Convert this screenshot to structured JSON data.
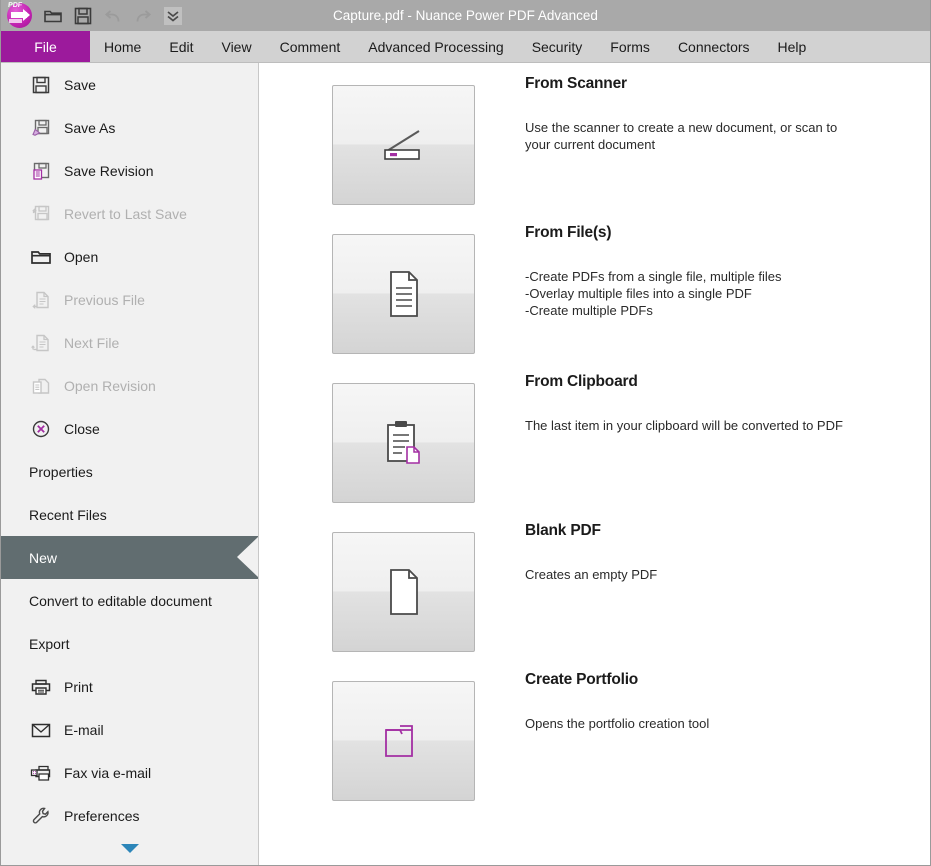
{
  "window": {
    "title": "Capture.pdf - Nuance Power PDF Advanced",
    "logo_icon": "pdf-logo-icon"
  },
  "quick_access_toolbar": {
    "buttons": [
      {
        "name": "open-icon",
        "label": "Open",
        "enabled": true
      },
      {
        "name": "save-icon",
        "label": "Save",
        "enabled": true
      },
      {
        "name": "undo-icon",
        "label": "Undo",
        "enabled": false
      },
      {
        "name": "redo-icon",
        "label": "Redo",
        "enabled": false
      },
      {
        "name": "chevron-double-down-icon",
        "label": "Customize Quick Access Toolbar",
        "enabled": true
      }
    ]
  },
  "menubar": {
    "items": [
      {
        "label": "File",
        "active": true
      },
      {
        "label": "Home",
        "active": false
      },
      {
        "label": "Edit",
        "active": false
      },
      {
        "label": "View",
        "active": false
      },
      {
        "label": "Comment",
        "active": false
      },
      {
        "label": "Advanced Processing",
        "active": false
      },
      {
        "label": "Security",
        "active": false
      },
      {
        "label": "Forms",
        "active": false
      },
      {
        "label": "Connectors",
        "active": false
      },
      {
        "label": "Help",
        "active": false
      }
    ]
  },
  "sidebar": {
    "items": [
      {
        "label": "Save",
        "icon": "save-floppy-icon",
        "state": "enabled"
      },
      {
        "label": "Save As",
        "icon": "save-as-icon",
        "state": "enabled"
      },
      {
        "label": "Save Revision",
        "icon": "save-revision-icon",
        "state": "enabled"
      },
      {
        "label": "Revert to Last Save",
        "icon": "revert-to-last-save-icon",
        "state": "disabled"
      },
      {
        "label": "Open",
        "icon": "folder-open-icon",
        "state": "enabled"
      },
      {
        "label": "Previous File",
        "icon": "previous-file-icon",
        "state": "disabled"
      },
      {
        "label": "Next File",
        "icon": "next-file-icon",
        "state": "disabled"
      },
      {
        "label": "Open Revision",
        "icon": "open-revision-icon",
        "state": "disabled"
      },
      {
        "label": "Close",
        "icon": "close-circle-icon",
        "state": "enabled"
      },
      {
        "label": "Properties",
        "icon": "",
        "state": "enabled"
      },
      {
        "label": "Recent Files",
        "icon": "",
        "state": "enabled"
      },
      {
        "label": "New",
        "icon": "",
        "state": "selected"
      },
      {
        "label": "Convert to editable document",
        "icon": "",
        "state": "enabled"
      },
      {
        "label": "Export",
        "icon": "",
        "state": "enabled"
      },
      {
        "label": "Print",
        "icon": "printer-icon",
        "state": "enabled"
      },
      {
        "label": "E-mail",
        "icon": "envelope-icon",
        "state": "enabled"
      },
      {
        "label": "Fax via e-mail",
        "icon": "fax-icon",
        "state": "enabled"
      },
      {
        "label": "Preferences",
        "icon": "wrench-icon",
        "state": "enabled"
      }
    ],
    "scroll_down_icon": "triangle-down-icon"
  },
  "main": {
    "rows": [
      {
        "title": "From Scanner",
        "desc": "Use the scanner to create a new document, or scan to\nyour current document",
        "icon": "scanner-icon"
      },
      {
        "title": "From File(s)",
        "desc": "-Create PDFs from a single file, multiple files\n-Overlay multiple files into a single PDF\n-Create multiple PDFs",
        "icon": "document-lines-icon"
      },
      {
        "title": "From Clipboard",
        "desc": "The last item in your clipboard will be converted to PDF",
        "icon": "clipboard-icon"
      },
      {
        "title": "Blank PDF",
        "desc": "Creates an empty PDF",
        "icon": "blank-page-icon"
      },
      {
        "title": "Create Portfolio",
        "desc": "Opens the portfolio creation tool",
        "icon": "folder-portfolio-icon"
      }
    ]
  },
  "colors": {
    "titlebar": "#a9a9a9",
    "menubar": "#d2d2d2",
    "file_tab_accent": "#9c1a9c",
    "sidebar_bg": "#f1f1f1",
    "selected_item": "#616d70",
    "scroll_arrow": "#2d86b9",
    "brand_magenta": "#c423b3"
  }
}
